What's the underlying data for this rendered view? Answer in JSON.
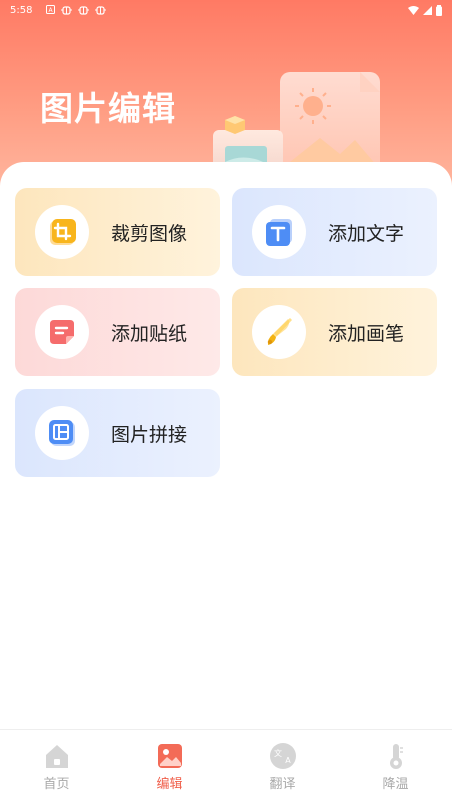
{
  "status_bar": {
    "time": "5:58",
    "notification_icons": [
      "a-icon",
      "bug-icon",
      "bug-icon",
      "bug-icon"
    ]
  },
  "header": {
    "title": "图片编辑"
  },
  "tools": [
    {
      "label": "裁剪图像",
      "icon": "crop-icon",
      "theme": "yellow"
    },
    {
      "label": "添加文字",
      "icon": "text-icon",
      "theme": "blue"
    },
    {
      "label": "添加贴纸",
      "icon": "sticker-icon",
      "theme": "pink"
    },
    {
      "label": "添加画笔",
      "icon": "brush-icon",
      "theme": "yellow"
    },
    {
      "label": "图片拼接",
      "icon": "collage-icon",
      "theme": "blue"
    }
  ],
  "bottom_nav": {
    "items": [
      {
        "label": "首页",
        "icon": "home-icon",
        "active": false
      },
      {
        "label": "编辑",
        "icon": "image-edit-icon",
        "active": true
      },
      {
        "label": "翻译",
        "icon": "translate-icon",
        "active": false
      },
      {
        "label": "降温",
        "icon": "thermometer-icon",
        "active": false
      }
    ]
  },
  "colors": {
    "header_top": "#ff7a64",
    "active_tab": "#f0604c",
    "inactive_tab": "#a9a9a9"
  }
}
